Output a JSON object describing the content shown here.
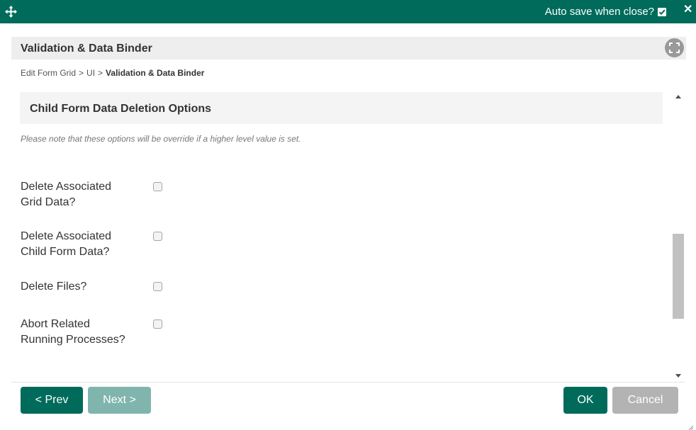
{
  "topbar": {
    "autosave_label": "Auto save when close?",
    "autosave_checked": true,
    "icons": {
      "move": "move-arrows-icon",
      "close": "close-icon",
      "checkbox": "checkbox-checked-icon"
    }
  },
  "header": {
    "title": "Validation & Data Binder",
    "maximize_icon": "maximize-icon"
  },
  "breadcrumb": {
    "items": [
      "Edit Form Grid",
      "UI",
      "Validation & Data Binder"
    ],
    "separator": ">"
  },
  "section": {
    "title": "Child Form Data Deletion Options",
    "note": "Please note that these options will be override if a higher level value is set."
  },
  "fields": [
    {
      "label_line1": "Delete Associated",
      "label_line2": "Grid Data?",
      "checked": false
    },
    {
      "label_line1": "Delete Associated",
      "label_line2": "Child Form Data?",
      "checked": false
    },
    {
      "label_line1": "Delete Files?",
      "label_line2": "",
      "checked": false
    },
    {
      "label_line1": "Abort Related",
      "label_line2": "Running Processes?",
      "checked": false
    }
  ],
  "footer": {
    "prev_label": "< Prev",
    "next_label": "Next >",
    "ok_label": "OK",
    "cancel_label": "Cancel"
  },
  "colors": {
    "primary": "#006b5b",
    "disabled": "#80b5ad",
    "cancel": "#b3b3b3"
  }
}
